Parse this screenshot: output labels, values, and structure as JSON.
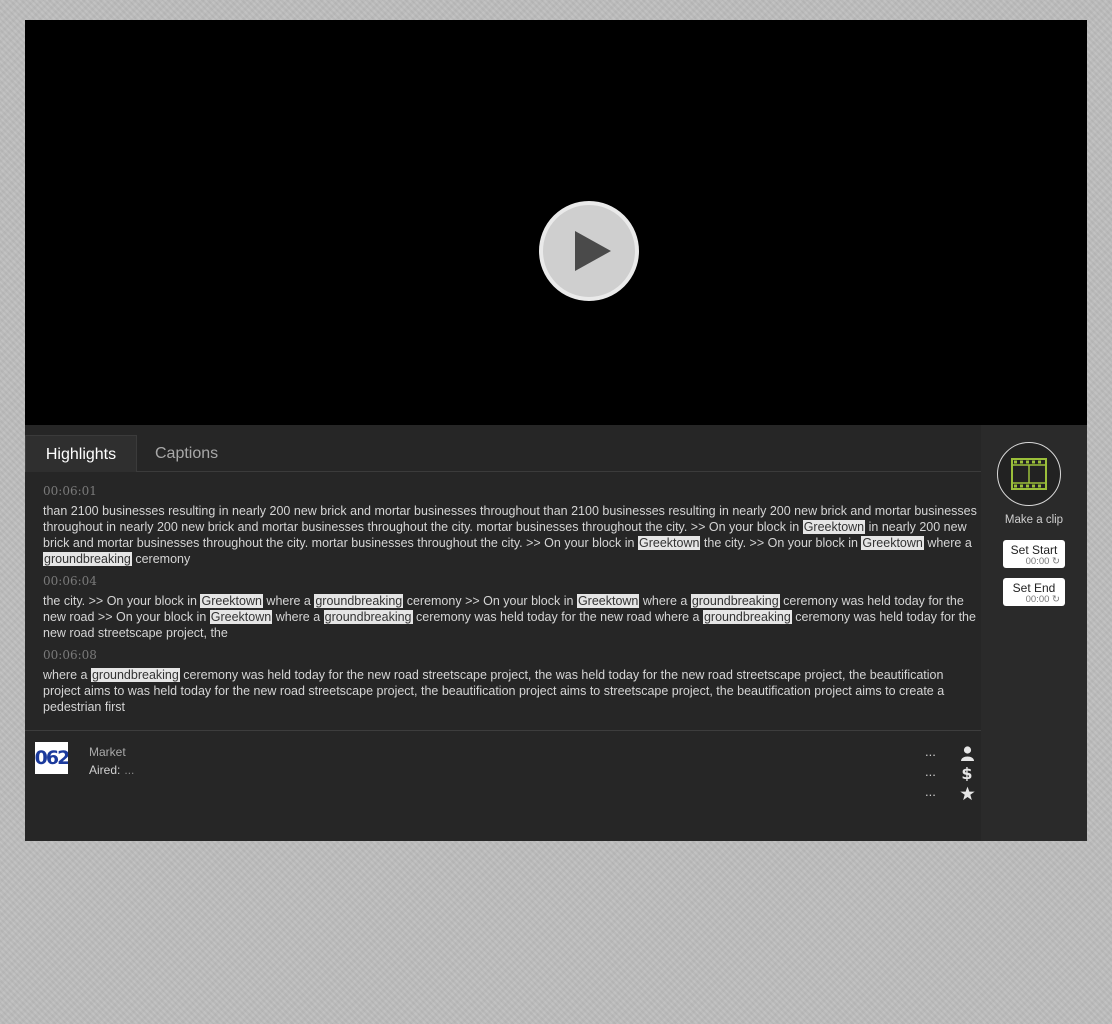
{
  "tabs": [
    {
      "label": "Highlights"
    },
    {
      "label": "Captions"
    }
  ],
  "segments": [
    {
      "timestamp": "00:06:01",
      "parts": [
        {
          "t": "than 2100 businesses resulting in nearly 200 new brick and mortar businesses throughout than 2100 businesses resulting in nearly 200 new brick and mortar businesses throughout in nearly 200 new brick and mortar businesses throughout the city. mortar businesses throughout the city. >> On your block in "
        },
        {
          "t": "Greektown",
          "hl": true
        },
        {
          "t": " in nearly 200 new brick and mortar businesses throughout the city. mortar businesses throughout the city. >> On your block in "
        },
        {
          "t": "Greektown",
          "hl": true
        },
        {
          "t": " the city. >> On your block in "
        },
        {
          "t": "Greektown",
          "hl": true
        },
        {
          "t": " where a "
        },
        {
          "t": "groundbreaking",
          "hl": true
        },
        {
          "t": " ceremony"
        }
      ]
    },
    {
      "timestamp": "00:06:04",
      "parts": [
        {
          "t": "the city. >> On your block in "
        },
        {
          "t": "Greektown",
          "hl": true
        },
        {
          "t": " where a "
        },
        {
          "t": "groundbreaking",
          "hl": true
        },
        {
          "t": " ceremony >> On your block in "
        },
        {
          "t": "Greektown",
          "hl": true
        },
        {
          "t": " where a "
        },
        {
          "t": "groundbreaking",
          "hl": true
        },
        {
          "t": " ceremony was held today for the new road >> On your block in "
        },
        {
          "t": "Greektown",
          "hl": true
        },
        {
          "t": " where a "
        },
        {
          "t": "groundbreaking",
          "hl": true
        },
        {
          "t": " ceremony was held today for the new road where a "
        },
        {
          "t": "groundbreaking",
          "hl": true
        },
        {
          "t": " ceremony was held today for the new road streetscape project, the"
        }
      ]
    },
    {
      "timestamp": "00:06:08",
      "parts": [
        {
          "t": "where a "
        },
        {
          "t": "groundbreaking",
          "hl": true
        },
        {
          "t": " ceremony was held today for the new road streetscape project, the was held today for the new road streetscape project, the beautification project aims to was held today for the new road streetscape project, the beautification project aims to streetscape project, the beautification project aims to create a pedestrian first"
        }
      ]
    }
  ],
  "info": {
    "logo_text": "062",
    "market_label": "Market",
    "aired_label": "Aired:",
    "aired_value": "...",
    "meta": [
      {
        "dots": "...",
        "icon": "person-icon"
      },
      {
        "dots": "...",
        "icon": "dollar-icon"
      },
      {
        "dots": "...",
        "icon": "star-icon"
      }
    ]
  },
  "clip": {
    "make_clip_label": "Make a clip",
    "set_start_label": "Set Start",
    "set_start_time": "00:00",
    "set_end_label": "Set End",
    "set_end_time": "00:00"
  },
  "colors": {
    "player_bg": "#262626",
    "video_bg": "#000000",
    "highlight_bg": "#e5e5e5",
    "clip_icon": "#9bbf3a"
  }
}
